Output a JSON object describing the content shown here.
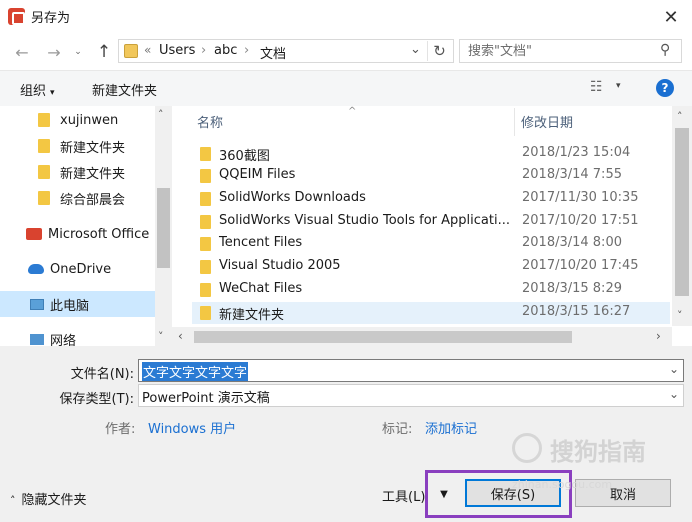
{
  "window": {
    "title": "另存为",
    "close_glyph": "✕"
  },
  "nav": {
    "back_glyph": "←",
    "forward_glyph": "→",
    "recent_glyph": "⌄",
    "up_glyph": "↑",
    "address": {
      "prefix": "«",
      "crumbs": [
        "Users",
        "abc",
        "文档"
      ],
      "separator": "›",
      "dropdown_glyph": "⌄",
      "refresh_glyph": "↻"
    },
    "search_placeholder": "搜索\"文档\"",
    "search_icon_glyph": "⚲"
  },
  "toolbar": {
    "organize_label": "组织",
    "organize_arrow": "▾",
    "new_folder_label": "新建文件夹",
    "view_glyph": "☷",
    "view_dropdown_glyph": "▾",
    "help_glyph": "?"
  },
  "sidebar": {
    "items": [
      {
        "label": "xujinwen",
        "kind": "folder"
      },
      {
        "label": "新建文件夹",
        "kind": "folder"
      },
      {
        "label": "新建文件夹",
        "kind": "folder"
      },
      {
        "label": "综合部晨会",
        "kind": "folder"
      },
      {
        "label": "Microsoft Office",
        "kind": "office"
      },
      {
        "label": "OneDrive",
        "kind": "cloud"
      },
      {
        "label": "此电脑",
        "kind": "pc"
      },
      {
        "label": "网络",
        "kind": "network"
      }
    ],
    "scroll_up_glyph": "˄",
    "scroll_down_glyph": "˅"
  },
  "file_list": {
    "columns": {
      "name": "名称",
      "date": "修改日期"
    },
    "sort_glyph": "^",
    "rows": [
      {
        "name": "360截图",
        "date": "2018/1/23 15:04"
      },
      {
        "name": "QQEIM Files",
        "date": "2018/3/14 7:55"
      },
      {
        "name": "SolidWorks Downloads",
        "date": "2017/11/30 10:35"
      },
      {
        "name": "SolidWorks Visual Studio Tools for Applicati...",
        "date": "2017/10/20 17:51"
      },
      {
        "name": "Tencent Files",
        "date": "2018/3/14 8:00"
      },
      {
        "name": "Visual Studio 2005",
        "date": "2017/10/20 17:45"
      },
      {
        "name": "WeChat Files",
        "date": "2018/3/15 8:29"
      },
      {
        "name": "新建文件夹",
        "date": "2018/3/15 16:27"
      }
    ],
    "selected_row": 7,
    "scroll_up_glyph": "˄",
    "scroll_down_glyph": "˅",
    "scroll_left_glyph": "‹",
    "scroll_right_glyph": "›"
  },
  "form": {
    "filename_label": "文件名(N):",
    "filename_value": "文字文字文字文字",
    "filetype_label": "保存类型(T):",
    "filetype_value": "PowerPoint 演示文稿",
    "dropdown_glyph": "⌄",
    "author_label": "作者:",
    "author_value": "Windows 用户",
    "tags_label": "标记:",
    "tags_value": "添加标记",
    "hide_folders_label": "隐藏文件夹",
    "hide_folders_arrow": "˄",
    "tools_label": "工具(L)",
    "tools_dropdown_glyph": "▼",
    "save_label": "保存(S)",
    "cancel_label": "取消"
  },
  "watermark": {
    "text": "搜狗指南",
    "url": "zhinan.sogou.com"
  },
  "colors": {
    "accent": "#0078d7",
    "selection": "#2b7bd3",
    "highlight_box": "#8a3fbf",
    "link": "#1a6fd1",
    "folder": "#f3c743"
  }
}
